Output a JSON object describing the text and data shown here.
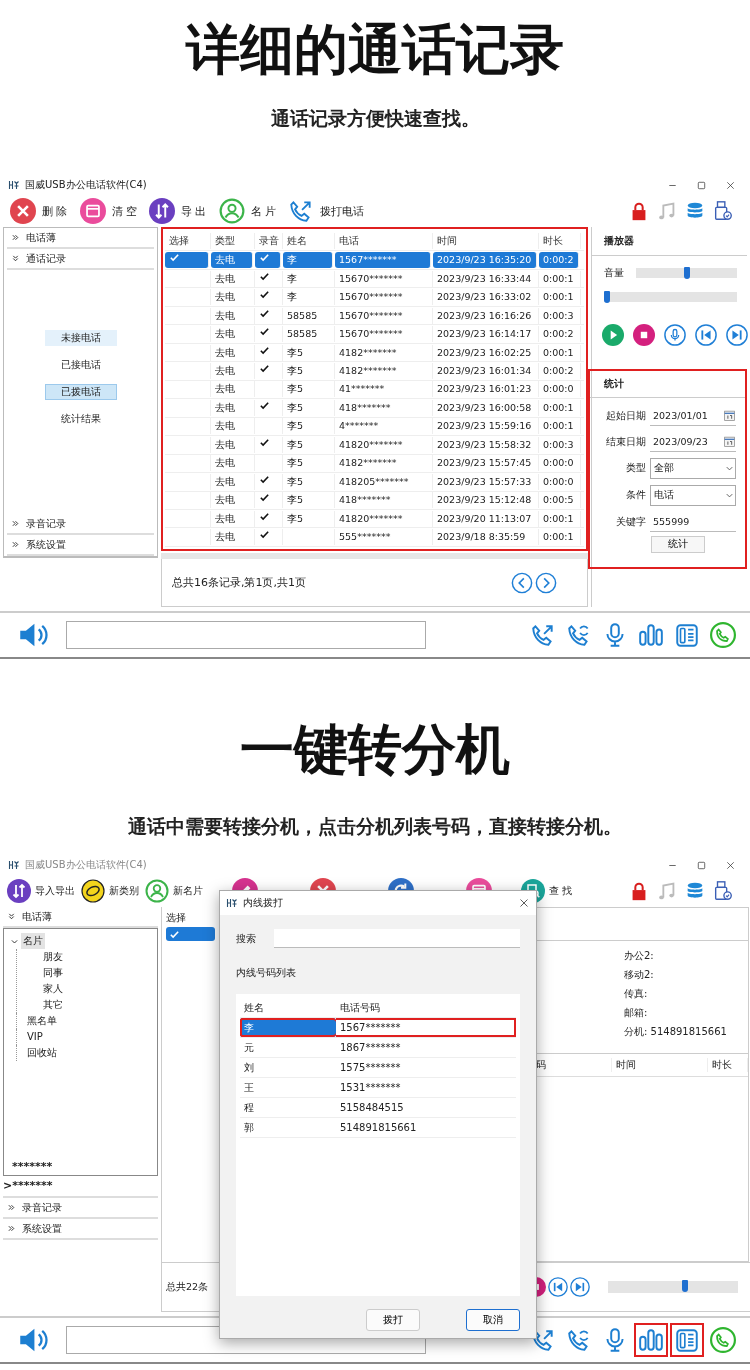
{
  "section1": {
    "title": "详细的通话记录",
    "subtitle": "通话记录方便快速查找。"
  },
  "window1": {
    "title": "国威USB办公电话软件(C4)",
    "dimmed": false,
    "toolbar": [
      {
        "label": "删 除"
      },
      {
        "label": "清 空"
      },
      {
        "label": "导 出"
      },
      {
        "label": "名 片"
      },
      {
        "label": "拨打电话"
      }
    ],
    "sidebar": [
      {
        "label": "电话薄",
        "expanded": false
      },
      {
        "label": "通话记录",
        "expanded": true,
        "children": [
          {
            "label": "未接电话",
            "selected": false,
            "hovered": true
          },
          {
            "label": "已接电话",
            "selected": false,
            "hovered": false
          },
          {
            "label": "已拨电话",
            "selected": true,
            "hovered": false
          },
          {
            "label": "统计结果",
            "selected": false,
            "hovered": false
          }
        ]
      },
      {
        "label": "录音记录",
        "expanded": false
      },
      {
        "label": "系统设置",
        "expanded": false
      }
    ],
    "table": {
      "highlighted": true,
      "columns": [
        "选择",
        "类型",
        "录音",
        "姓名",
        "电话",
        "时间",
        "时长"
      ],
      "rows": [
        {
          "selected": true,
          "type": "去电",
          "recorded": true,
          "name": "李",
          "phone": "1567*******",
          "time": "2023/9/23 16:35:20",
          "duration": "0:00:2"
        },
        {
          "selected": false,
          "type": "去电",
          "recorded": true,
          "name": "李",
          "phone": "15670*******",
          "time": "2023/9/23 16:33:44",
          "duration": "0:00:1"
        },
        {
          "selected": false,
          "type": "去电",
          "recorded": true,
          "name": "李",
          "phone": "15670*******",
          "time": "2023/9/23 16:33:02",
          "duration": "0:00:1"
        },
        {
          "selected": false,
          "type": "去电",
          "recorded": true,
          "name": "58585",
          "phone": "15670*******",
          "time": "2023/9/23 16:16:26",
          "duration": "0:00:3"
        },
        {
          "selected": false,
          "type": "去电",
          "recorded": true,
          "name": "58585",
          "phone": "15670*******",
          "time": "2023/9/23 16:14:17",
          "duration": "0:00:2"
        },
        {
          "selected": false,
          "type": "去电",
          "recorded": true,
          "name": "李5",
          "phone": "4182*******",
          "time": "2023/9/23 16:02:25",
          "duration": "0:00:1"
        },
        {
          "selected": false,
          "type": "去电",
          "recorded": true,
          "name": "李5",
          "phone": "4182*******",
          "time": "2023/9/23 16:01:34",
          "duration": "0:00:2"
        },
        {
          "selected": false,
          "type": "去电",
          "recorded": false,
          "name": "李5",
          "phone": "41*******",
          "time": "2023/9/23 16:01:23",
          "duration": "0:00:0"
        },
        {
          "selected": false,
          "type": "去电",
          "recorded": true,
          "name": "李5",
          "phone": "418*******",
          "time": "2023/9/23 16:00:58",
          "duration": "0:00:1"
        },
        {
          "selected": false,
          "type": "去电",
          "recorded": false,
          "name": "李5",
          "phone": "4*******",
          "time": "2023/9/23 15:59:16",
          "duration": "0:00:1"
        },
        {
          "selected": false,
          "type": "去电",
          "recorded": true,
          "name": "李5",
          "phone": "41820*******",
          "time": "2023/9/23 15:58:32",
          "duration": "0:00:3"
        },
        {
          "selected": false,
          "type": "去电",
          "recorded": false,
          "name": "李5",
          "phone": "4182*******",
          "time": "2023/9/23 15:57:45",
          "duration": "0:00:0"
        },
        {
          "selected": false,
          "type": "去电",
          "recorded": true,
          "name": "李5",
          "phone": "418205*******",
          "time": "2023/9/23 15:57:33",
          "duration": "0:00:0"
        },
        {
          "selected": false,
          "type": "去电",
          "recorded": true,
          "name": "李5",
          "phone": "418*******",
          "time": "2023/9/23 15:12:48",
          "duration": "0:00:5"
        },
        {
          "selected": false,
          "type": "去电",
          "recorded": true,
          "name": "李5",
          "phone": "41820*******",
          "time": "2023/9/20 11:13:07",
          "duration": "0:00:1"
        },
        {
          "selected": false,
          "type": "去电",
          "recorded": true,
          "name": "",
          "phone": "555*******",
          "time": "2023/9/18 8:35:59",
          "duration": "0:00:1"
        }
      ]
    },
    "pager": "总共16条记录,第1页,共1页",
    "player": {
      "title": "播放器",
      "volume_label": "音量",
      "volume": {
        "level": 0.5
      },
      "progress": {
        "level": 0
      }
    },
    "stats": {
      "highlighted": true,
      "title": "统计",
      "fields": [
        {
          "kind": "date",
          "label": "起始日期",
          "value": "2023/01/01"
        },
        {
          "kind": "date",
          "label": "结束日期",
          "value": "2023/09/23"
        },
        {
          "kind": "select",
          "label": "类型",
          "value": "全部"
        },
        {
          "kind": "select",
          "label": "条件",
          "value": "电话"
        },
        {
          "kind": "text",
          "label": "关键字",
          "value": "555999"
        }
      ],
      "button": "统计"
    },
    "bottom_bar": {
      "icons": [
        {
          "highlighted": false
        },
        {
          "highlighted": false
        },
        {
          "highlighted": false
        },
        {
          "highlighted": false
        },
        {
          "highlighted": false
        },
        {
          "highlighted": false
        }
      ]
    }
  },
  "section2": {
    "title": "一键转分机",
    "subtitle": "通话中需要转接分机，点击分机列表号码，直接转接分机。"
  },
  "window2": {
    "title": "国威USB办公电话软件(C4)",
    "dimmed": true,
    "toolbar_left": [
      {
        "label": "导入导出"
      },
      {
        "label": "新类别"
      },
      {
        "label": "新名片"
      }
    ],
    "toolbar_right": [
      {
        "label": "查 找"
      }
    ],
    "sidebar": {
      "header": {
        "label": "电话薄",
        "expanded": true
      },
      "tree": [
        {
          "label": "名片",
          "expanded": true,
          "selected": true,
          "children": [
            {
              "label": "朋友",
              "selected": false
            },
            {
              "label": "同事",
              "selected": false
            },
            {
              "label": "家人",
              "selected": false
            },
            {
              "label": "其它",
              "selected": false
            }
          ]
        },
        {
          "label": "黑名单",
          "selected": false
        },
        {
          "label": "VIP",
          "selected": false
        },
        {
          "label": "回收站",
          "selected": false
        }
      ],
      "tree_footer": "*******",
      "items": [
        {
          "kind": "plain",
          "label": ">*******"
        },
        {
          "kind": "section",
          "label": "录音记录",
          "expanded": false
        },
        {
          "kind": "section",
          "label": "系统设置",
          "expanded": false
        }
      ]
    },
    "list": {
      "column": "选择",
      "first_row_checked": true
    },
    "details": [
      "办公2:",
      "移动2:",
      "传真:",
      "邮箱:",
      "分机: 514891815661"
    ],
    "calls_columns": [
      "码",
      "时间",
      "时长"
    ],
    "pager": "总共22条",
    "player": {
      "progress": {
        "level": 0.6
      }
    },
    "bottom_bar": {
      "icons": [
        {
          "highlighted": false
        },
        {
          "highlighted": false
        },
        {
          "highlighted": false
        },
        {
          "highlighted": true
        },
        {
          "highlighted": true
        },
        {
          "highlighted": false
        }
      ]
    },
    "dialog": {
      "title": "内线拨打",
      "search_label": "搜索",
      "list_label": "内线号码列表",
      "columns": [
        "姓名",
        "电话号码"
      ],
      "rows": [
        {
          "name": "李",
          "phone": "1567*******",
          "selected": true,
          "highlighted": true
        },
        {
          "name": "元",
          "phone": "1867*******",
          "selected": false,
          "highlighted": false
        },
        {
          "name": "刘",
          "phone": "1575*******",
          "selected": false,
          "highlighted": false
        },
        {
          "name": "王",
          "phone": "1531*******",
          "selected": false,
          "highlighted": false
        },
        {
          "name": "程",
          "phone": "5158484515",
          "selected": false,
          "highlighted": false
        },
        {
          "name": "郭",
          "phone": "514891815661",
          "selected": false,
          "highlighted": false
        }
      ],
      "buttons": [
        {
          "label": "拨打",
          "default": false
        },
        {
          "label": "取消",
          "default": true
        }
      ]
    }
  }
}
